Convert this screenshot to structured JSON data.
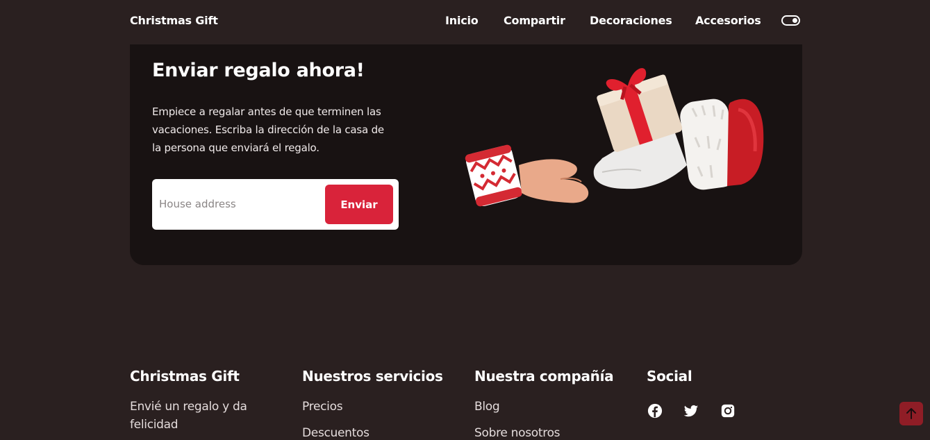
{
  "header": {
    "logo": "Christmas Gift",
    "nav": [
      "Inicio",
      "Compartir",
      "Decoraciones",
      "Accesorios"
    ]
  },
  "send": {
    "title": "Enviar regalo ahora!",
    "description": "Empiece a regalar antes de que terminen las vacaciones. Escriba la dirección de la casa de la persona que enviará el regalo.",
    "input_placeholder": "House address",
    "button_label": "Enviar",
    "illustration": "gift-handover-illustration"
  },
  "footer": {
    "brand": {
      "title": "Christmas Gift",
      "text": "Envié un regalo y da felicidad"
    },
    "services": {
      "title": "Nuestros servicios",
      "links": [
        "Precios",
        "Descuentos"
      ]
    },
    "company": {
      "title": "Nuestra compañía",
      "links": [
        "Blog",
        "Sobre nosotros"
      ]
    },
    "social": {
      "title": "Social",
      "icons": [
        "facebook-icon",
        "twitter-icon",
        "instagram-icon"
      ]
    }
  },
  "colors": {
    "background": "#2a2020",
    "card": "#181212",
    "accent": "#d9233a",
    "scroll_button": "#8f1d26"
  }
}
